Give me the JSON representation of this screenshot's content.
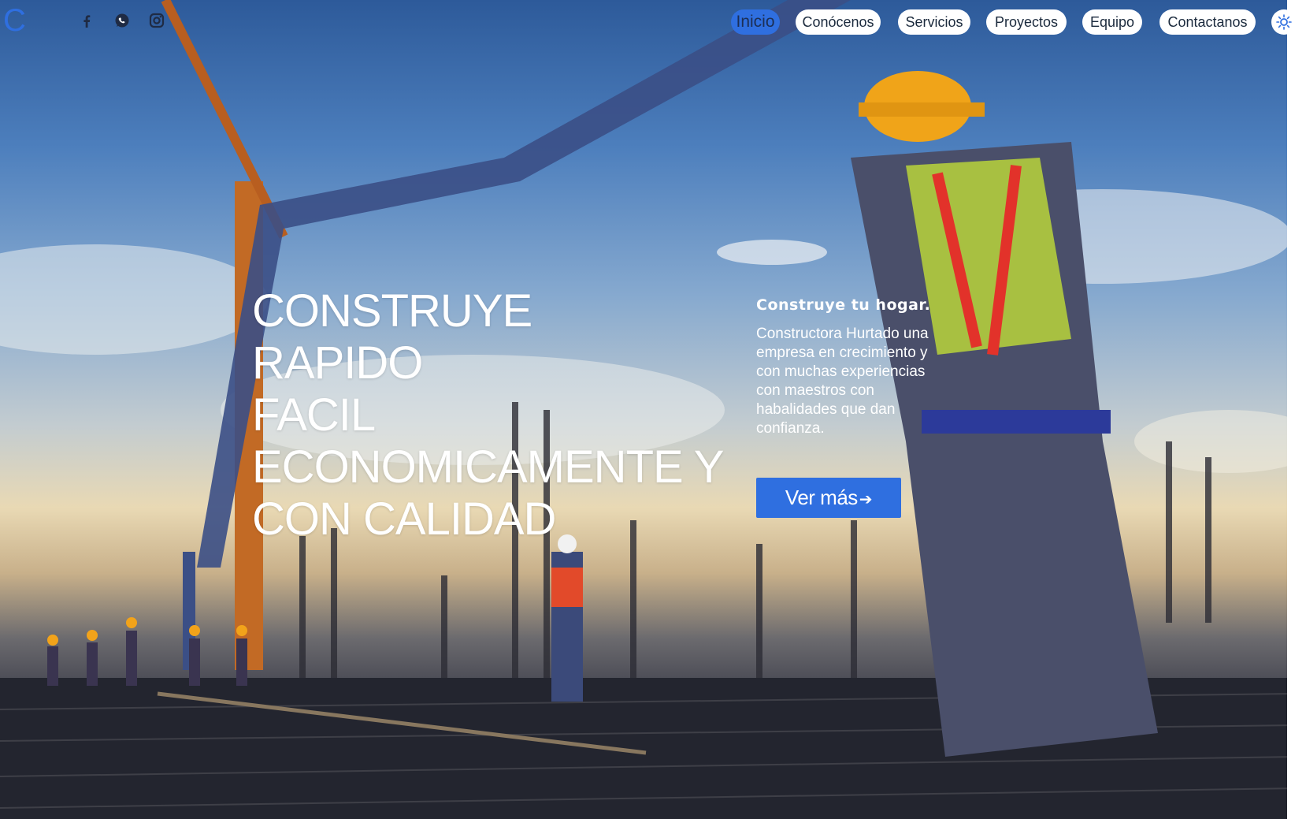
{
  "brand": {
    "logo_letter": "C"
  },
  "social": [
    {
      "icon": "facebook-icon"
    },
    {
      "icon": "whatsapp-icon"
    },
    {
      "icon": "instagram-icon"
    }
  ],
  "nav": {
    "items": [
      {
        "label": "Inicio",
        "active": true
      },
      {
        "label": "Conócenos"
      },
      {
        "label": "Servicios"
      },
      {
        "label": "Proyectos"
      },
      {
        "label": "Equipo"
      },
      {
        "label": "Contactanos"
      }
    ],
    "theme_toggle_icon": "sun-icon"
  },
  "hero": {
    "headline_lines": [
      "CONSTRUYE",
      "RAPIDO",
      "FACIL",
      "ECONOMICAMENTE Y",
      "CON CALIDAD"
    ],
    "kicker": "Construye tu hogar.",
    "description": "Constructora Hurtado una empresa en crecimiento y con muchas experiencias con maestros con habalidades que dan confianza.",
    "cta_label": "Ver más",
    "cta_icon": "arrow-right-icon"
  },
  "colors": {
    "accent": "#2f6fe0",
    "nav_bg": "#ffffff",
    "nav_text": "#1b2a3d"
  }
}
